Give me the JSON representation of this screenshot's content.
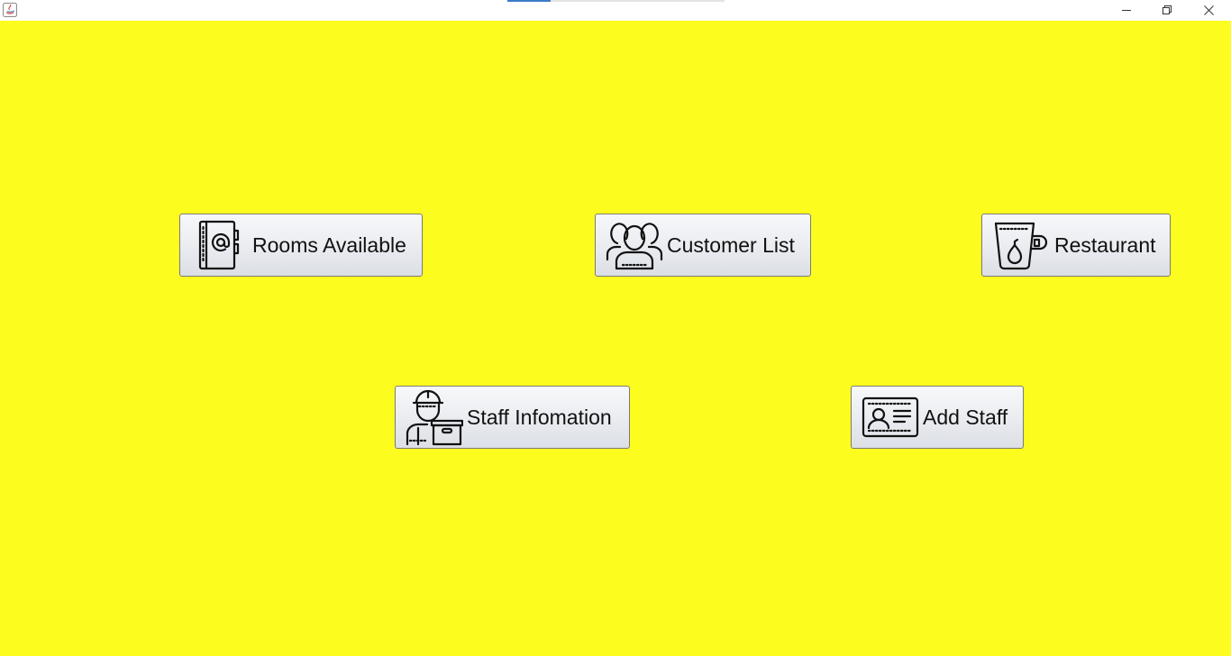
{
  "window": {
    "background_color": "#fcfc1f",
    "title_progress": 0.2,
    "controls": {
      "minimize_icon": "minimize-icon",
      "maximize_icon": "restore-icon",
      "close_icon": "close-icon"
    }
  },
  "buttons": {
    "rooms": {
      "label": "Rooms Available",
      "icon": "address-book-icon"
    },
    "customers": {
      "label": "Customer List",
      "icon": "user-group-icon"
    },
    "restaurant": {
      "label": "Restaurant",
      "icon": "tea-cup-icon"
    },
    "staff_info": {
      "label": "Staff Infomation",
      "icon": "worker-with-box-icon"
    },
    "add_staff": {
      "label": "Add Staff",
      "icon": "id-card-icon"
    }
  }
}
